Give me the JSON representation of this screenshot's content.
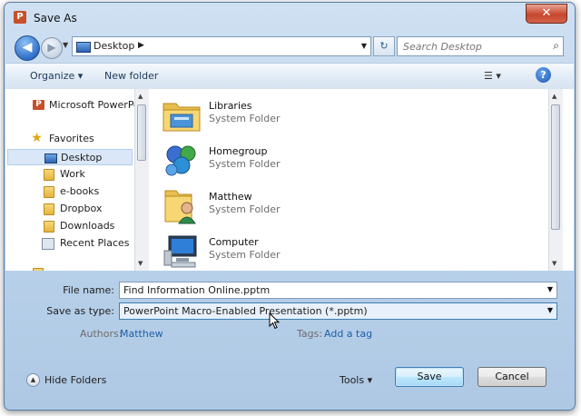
{
  "window": {
    "title": "Save As",
    "close_glyph": "✕",
    "app_icon_letter": "P"
  },
  "nav": {
    "back_glyph": "◀",
    "forward_glyph": "▶",
    "recent_glyph": "▼",
    "address": "Desktop",
    "address_chevron": "▶",
    "address_dropdown": "▼",
    "refresh_glyph": "↻",
    "search_placeholder": "Search Desktop",
    "search_glyph": "⌕"
  },
  "toolbar": {
    "organize": "Organize ▾",
    "new_folder": "New folder",
    "views": "☰ ▾",
    "help_glyph": "?"
  },
  "sidebar": {
    "items": [
      {
        "label": "Microsoft PowerPo",
        "icon": "powerpoint-icon"
      },
      {
        "label": "Favorites",
        "icon": "star-icon"
      },
      {
        "label": "Desktop",
        "icon": "desktop-icon",
        "selected": true
      },
      {
        "label": "Work",
        "icon": "folder-icon"
      },
      {
        "label": "e-books",
        "icon": "folder-icon"
      },
      {
        "label": "Dropbox",
        "icon": "dropbox-icon"
      },
      {
        "label": "Downloads",
        "icon": "downloads-icon"
      },
      {
        "label": "Recent Places",
        "icon": "recent-places-icon"
      }
    ]
  },
  "files": [
    {
      "name": "Libraries",
      "type": "System Folder",
      "icon": "libraries-icon"
    },
    {
      "name": "Homegroup",
      "type": "System Folder",
      "icon": "homegroup-icon"
    },
    {
      "name": "Matthew",
      "type": "System Folder",
      "icon": "user-folder-icon"
    },
    {
      "name": "Computer",
      "type": "System Folder",
      "icon": "computer-icon"
    }
  ],
  "form": {
    "file_name_label": "File name:",
    "file_name_value": "Find Information Online.pptm",
    "save_type_label": "Save as type:",
    "save_type_value": "PowerPoint Macro-Enabled Presentation (*.pptm)",
    "authors_label": "Authors:",
    "authors_value": "Matthew",
    "tags_label": "Tags:",
    "tags_value": "Add a tag",
    "dropdown_glyph": "▼"
  },
  "footer": {
    "hide_folders": "Hide Folders",
    "hide_glyph": "▲",
    "tools": "Tools ▾",
    "save": "Save",
    "cancel": "Cancel"
  }
}
